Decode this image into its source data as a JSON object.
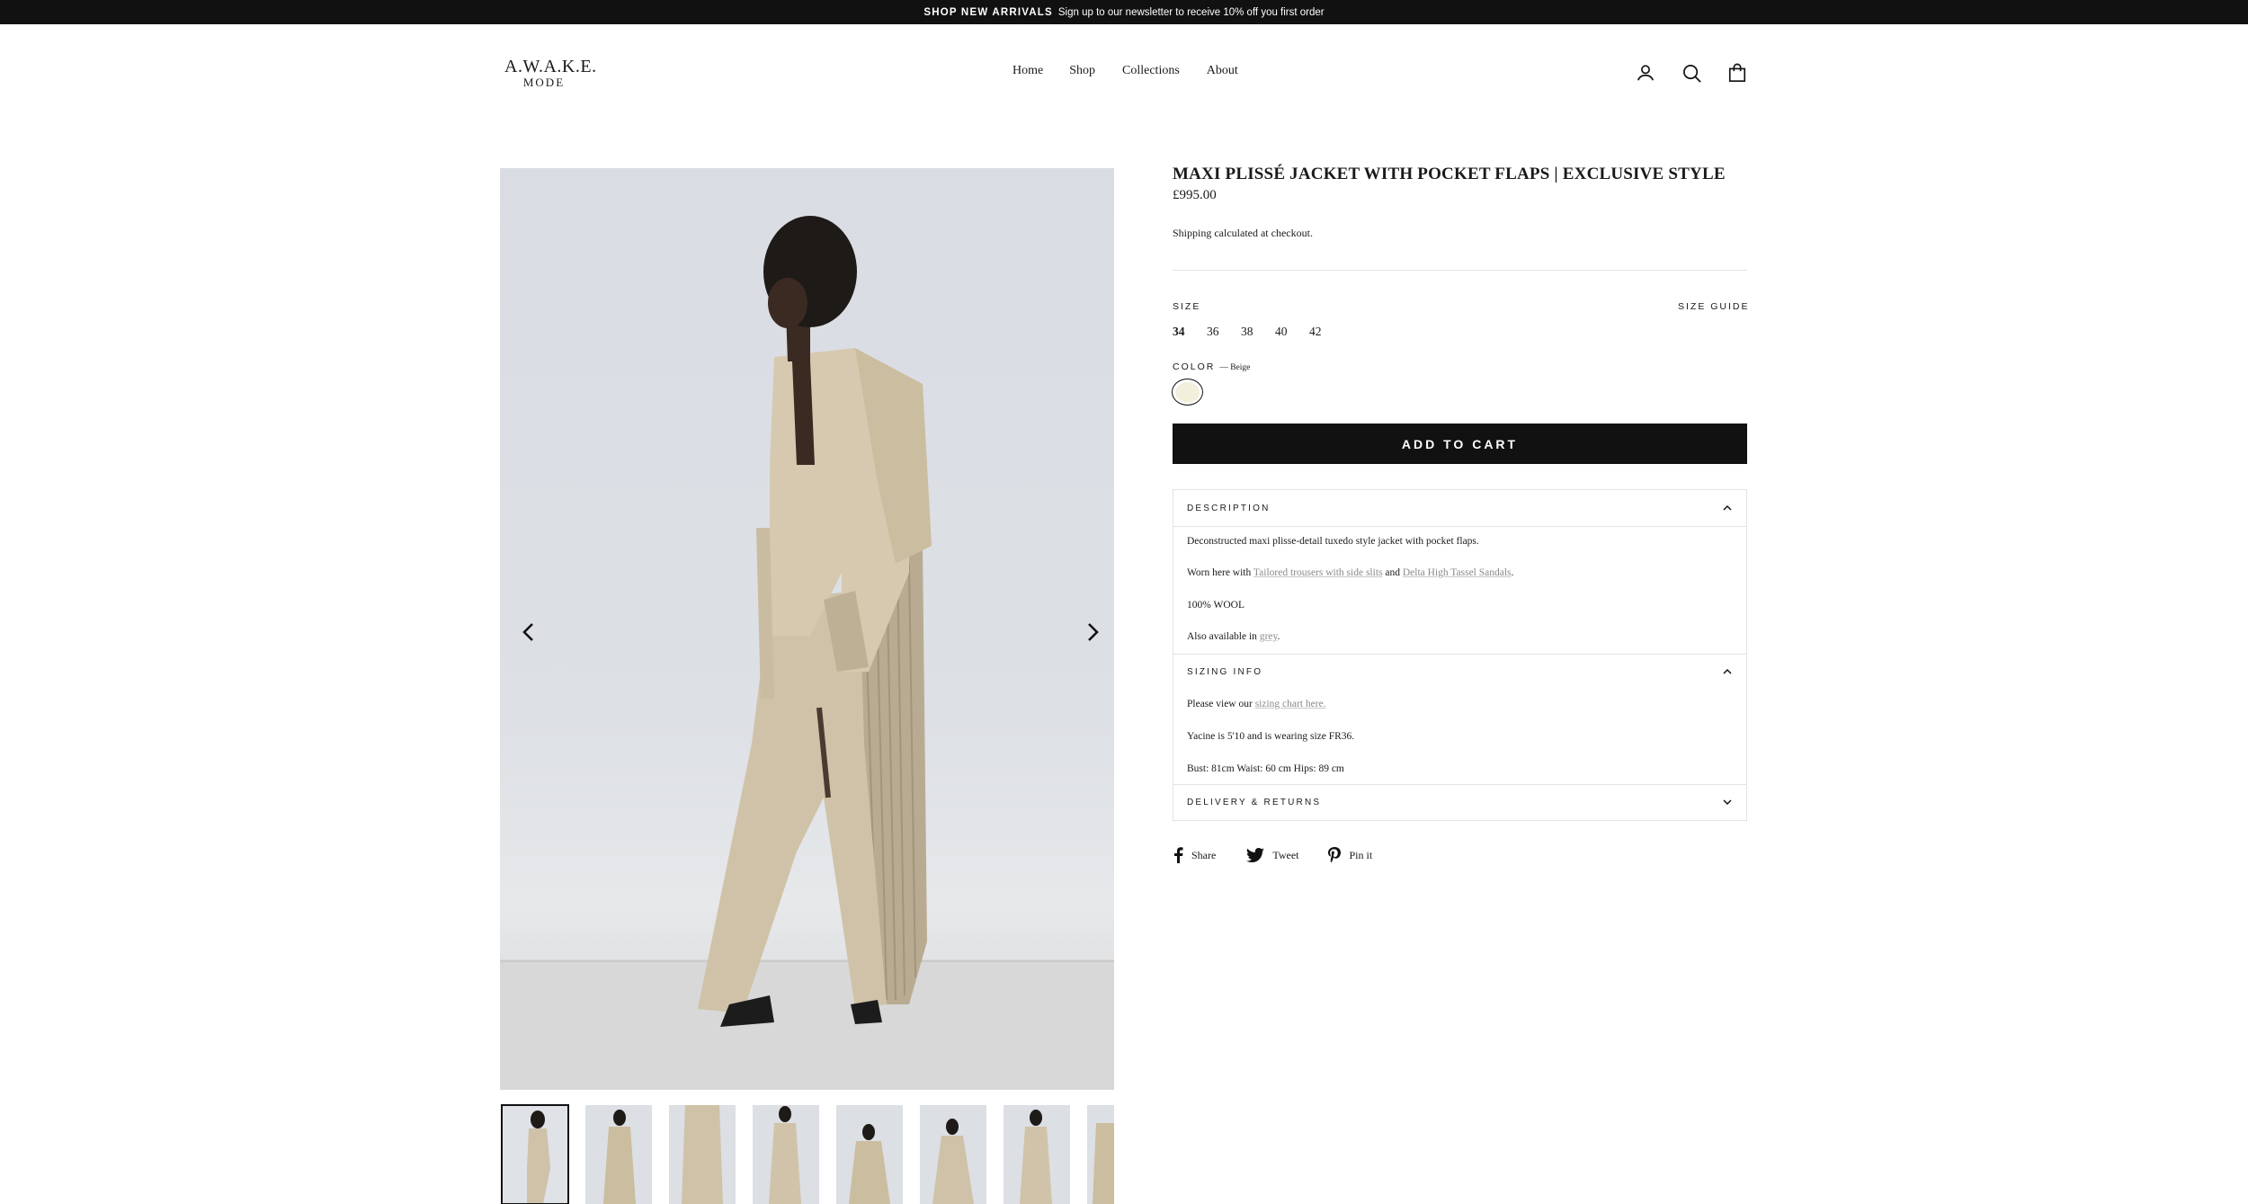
{
  "announcement": {
    "strong": "SHOP NEW ARRIVALS",
    "text": "Sign up to our newsletter to receive 10% off you first order"
  },
  "brand": {
    "line1": "A.W.A.K.E.",
    "line2": "MODE"
  },
  "nav": {
    "home": "Home",
    "shop": "Shop",
    "collections": "Collections",
    "about": "About"
  },
  "header_icons": [
    "account-icon",
    "search-icon",
    "cart-icon"
  ],
  "product": {
    "title": "MAXI PLISSÉ JACKET WITH POCKET FLAPS | EXCLUSIVE STYLE",
    "price": "£995.00",
    "shipping": "Shipping calculated at checkout.",
    "size_label": "SIZE",
    "size_guide": "SIZE GUIDE",
    "sizes": [
      "34",
      "36",
      "38",
      "40",
      "42"
    ],
    "selected_size": "34",
    "color_label": "COLOR",
    "color_value": "— Beige",
    "swatch_color": "#f2f0dc",
    "add_to_cart": "ADD TO CART"
  },
  "gallery": {
    "thumbnail_count": 8,
    "active_thumbnail": 1
  },
  "accordion": {
    "description": {
      "title": "DESCRIPTION",
      "p1": "Deconstructed maxi plisse-detail tuxedo style jacket with pocket flaps.",
      "p2_before": "Worn here with",
      "p2_link1": "Tailored trousers with side slits",
      "p2_mid": "and",
      "p2_link2": "Delta High Tassel Sandals",
      "p2_end": ".",
      "p3": "100% WOOL",
      "p4_before": "Also available in",
      "p4_link": "grey",
      "p4_end": "."
    },
    "sizing": {
      "title": "SIZING INFO",
      "p1_before": "Please view our",
      "p1_link": "sizing chart here.",
      "p2": "Yacine is 5'10 and is wearing size FR36.",
      "p3": "Bust: 81cm Waist: 60 cm Hips: 89 cm"
    },
    "delivery": {
      "title": "DELIVERY & RETURNS"
    }
  },
  "social": {
    "share": "Share",
    "tweet": "Tweet",
    "pin": "Pin it"
  },
  "colors": {
    "bar": "#111111",
    "link": "#8a8a8a",
    "border": "#e3e3e3"
  }
}
